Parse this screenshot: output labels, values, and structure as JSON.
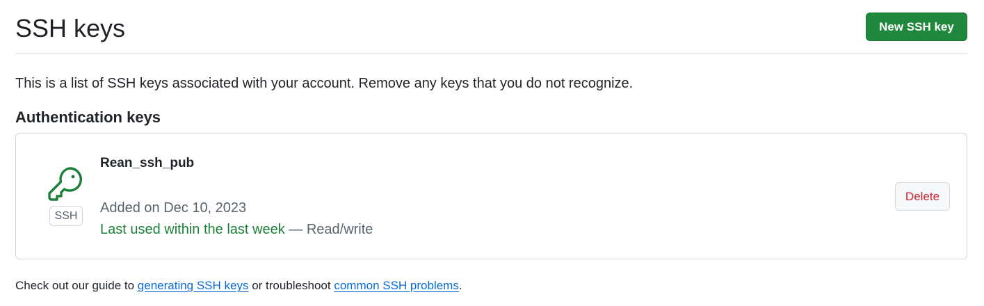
{
  "header": {
    "title": "SSH keys",
    "new_key_label": "New SSH key"
  },
  "intro": "This is a list of SSH keys associated with your account. Remove any keys that you do not recognize.",
  "auth_section": {
    "title": "Authentication keys",
    "keys": [
      {
        "icon": "key-icon",
        "type_badge": "SSH",
        "name": "Rean_ssh_pub",
        "added": "Added on Dec 10, 2023",
        "last_used": "Last used within the last week",
        "separator": " — ",
        "access": "Read/write",
        "delete_label": "Delete"
      }
    ]
  },
  "footer": {
    "prefix": "Check out our guide to ",
    "link1": "generating SSH keys",
    "middle": " or troubleshoot ",
    "link2": "common SSH problems",
    "suffix": "."
  },
  "colors": {
    "primary_button": "#1f883d",
    "success_text": "#1a7f37",
    "danger_text": "#cf222e",
    "link": "#0969da",
    "muted_text": "#59636e"
  }
}
